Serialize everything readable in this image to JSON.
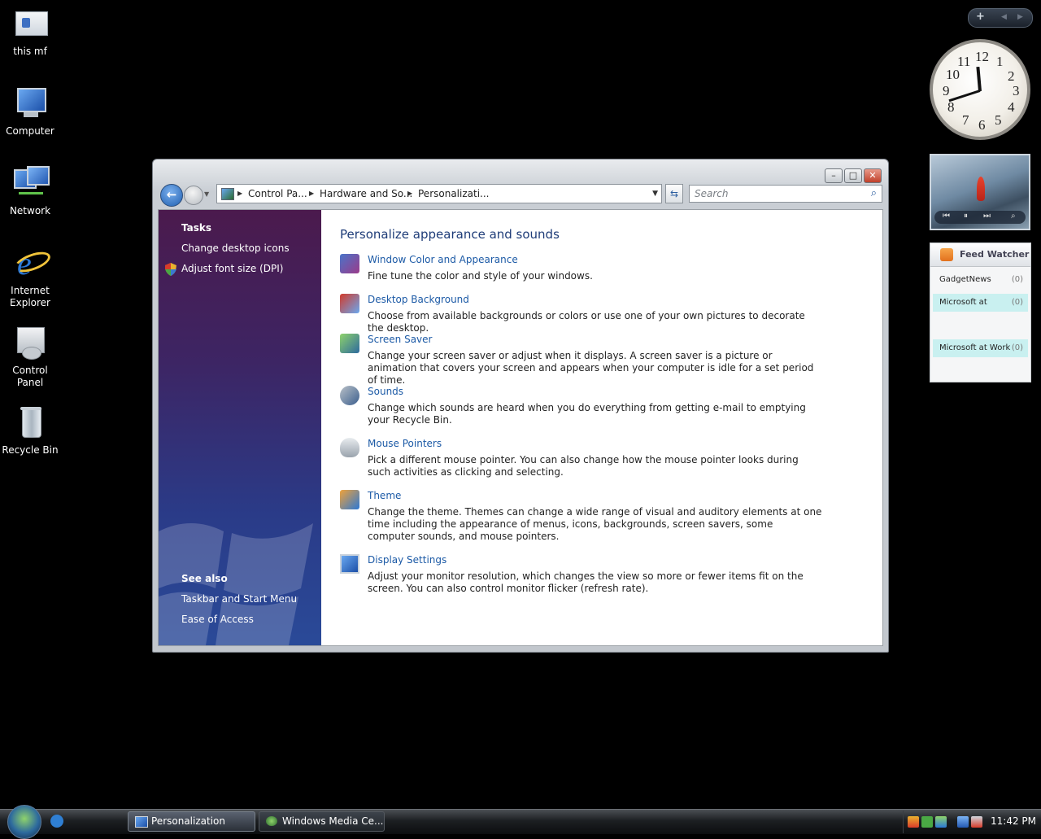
{
  "desktop_icons": [
    {
      "label": "this mf",
      "icon": "folder-icon"
    },
    {
      "label": "Computer",
      "icon": "computer-icon"
    },
    {
      "label": "Network",
      "icon": "network-icon"
    },
    {
      "label": "Internet Explorer",
      "icon": "internet-explorer-icon"
    },
    {
      "label": "Control Panel",
      "icon": "control-panel-icon"
    },
    {
      "label": "Recycle Bin",
      "icon": "recycle-bin-icon"
    }
  ],
  "sidebar": {
    "top_buttons": {
      "add": "+",
      "prev": "◀",
      "next": "▶"
    },
    "clock": {
      "numbers": [
        "12",
        "1",
        "2",
        "3",
        "4",
        "5",
        "6",
        "7",
        "8",
        "9",
        "10",
        "11"
      ]
    },
    "slideshow": {
      "controls": {
        "prev": "⏮",
        "pause": "⏸",
        "next": "⏭",
        "view": "⌕"
      }
    },
    "feed_watcher": {
      "title": "Feed Watcher",
      "items": [
        {
          "name": "GadgetNews",
          "count": "(0)"
        },
        {
          "name": "Microsoft at",
          "count": "(0)"
        },
        {
          "name": "Microsoft at Work",
          "count": "(0)"
        }
      ]
    }
  },
  "window": {
    "controls": {
      "minimize": "–",
      "maximize": "□",
      "close": "✕"
    },
    "address": {
      "segments": [
        "Control Pa...",
        "Hardware and So...",
        "Personalizati..."
      ],
      "separator": "▶",
      "dropdown": "▼"
    },
    "search_placeholder": "Search",
    "tasks_pane": {
      "tasks_header": "Tasks",
      "tasks": [
        "Change desktop icons",
        "Adjust font size (DPI)"
      ],
      "see_also_header": "See also",
      "see_also": [
        "Taskbar and Start Menu",
        "Ease of Access"
      ]
    },
    "main": {
      "title": "Personalize appearance and sounds",
      "items": [
        {
          "link": "Window Color and Appearance",
          "desc": "Fine tune the color and style of your windows.",
          "icon": "window-color-icon"
        },
        {
          "link": "Desktop Background",
          "desc": "Choose from available backgrounds or colors or use one of your own pictures to decorate the desktop.",
          "icon": "desktop-background-icon"
        },
        {
          "link": "Screen Saver",
          "desc": "Change your screen saver or adjust when it displays. A screen saver is a picture or animation that covers your screen and appears when your computer is idle for a set period of time.",
          "icon": "screen-saver-icon"
        },
        {
          "link": "Sounds",
          "desc": "Change which sounds are heard when you do everything from getting e-mail to emptying your Recycle Bin.",
          "icon": "sounds-icon"
        },
        {
          "link": "Mouse Pointers",
          "desc": "Pick a different mouse pointer. You can also change how the mouse pointer looks during such activities as clicking and selecting.",
          "icon": "mouse-pointers-icon"
        },
        {
          "link": "Theme",
          "desc": "Change the theme. Themes can change a wide range of visual and auditory elements at one time including the appearance of menus, icons, backgrounds, screen savers, some computer sounds, and mouse pointers.",
          "icon": "theme-icon"
        },
        {
          "link": "Display Settings",
          "desc": "Adjust your monitor resolution, which changes the view so more or fewer items fit on the screen. You can also control monitor flicker (refresh rate).",
          "icon": "display-settings-icon"
        }
      ]
    }
  },
  "taskbar": {
    "buttons": [
      {
        "label": "Personalization",
        "active": true
      },
      {
        "label": "Windows Media Ce...",
        "active": false
      }
    ],
    "clock": "11:42 PM"
  }
}
